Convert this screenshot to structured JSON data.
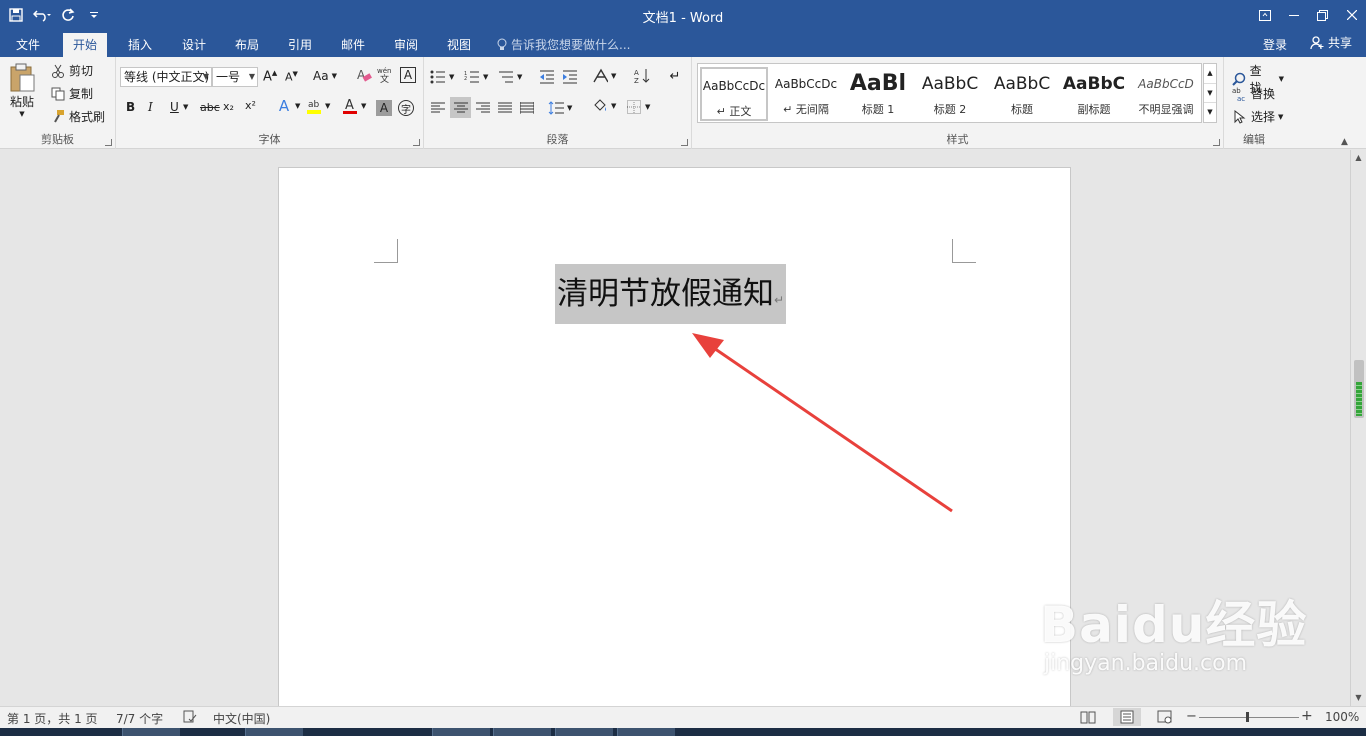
{
  "app": {
    "title": "文档1 - Word"
  },
  "tabs": [
    "文件",
    "开始",
    "插入",
    "设计",
    "布局",
    "引用",
    "邮件",
    "审阅",
    "视图"
  ],
  "tell_me": "告诉我您想要做什么...",
  "account": {
    "login": "登录",
    "share": "共享"
  },
  "clipboard": {
    "paste": "粘贴",
    "cut": "剪切",
    "copy": "复制",
    "format_painter": "格式刷",
    "label": "剪贴板"
  },
  "font": {
    "name": "等线 (中文正文)",
    "size": "一号",
    "label": "字体",
    "change_case": "Aa",
    "clear": "A",
    "bold": "B",
    "italic": "I",
    "underline": "U",
    "strike": "abc",
    "subscript": "x₂",
    "superscript": "x²",
    "color_letter": "A"
  },
  "paragraph": {
    "label": "段落"
  },
  "styles": {
    "label": "样式",
    "items": [
      {
        "preview": "AaBbCcDc",
        "name": "↵ 正文"
      },
      {
        "preview": "AaBbCcDc",
        "name": "↵ 无间隔"
      },
      {
        "preview": "AaBl",
        "name": "标题 1"
      },
      {
        "preview": "AaBbC",
        "name": "标题 2"
      },
      {
        "preview": "AaBbC",
        "name": "标题"
      },
      {
        "preview": "AaBbC",
        "name": "副标题"
      },
      {
        "preview": "AaBbCcD",
        "name": "不明显强调"
      }
    ]
  },
  "editing": {
    "find": "查找",
    "replace": "替换",
    "select": "选择",
    "label": "编辑"
  },
  "document": {
    "heading": "清明节放假通知",
    "para_mark": "↵"
  },
  "status": {
    "page": "第 1 页，共 1 页",
    "words": "7/7 个字",
    "language": "中文(中国)",
    "zoom": "100%"
  },
  "watermark": {
    "brand": "Baidu经验",
    "url": "jingyan.baidu.com"
  },
  "colors": {
    "ribbon_blue": "#2b579a",
    "arrow": "#e8413c",
    "highlight_yellow": "#ffff00",
    "font_red": "#e00000"
  }
}
